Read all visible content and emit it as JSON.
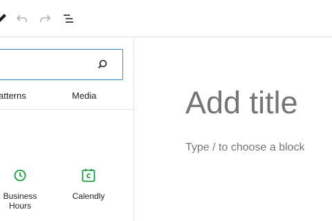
{
  "toolbar": {
    "items": [
      {
        "name": "edit-pencil-icon"
      },
      {
        "name": "undo-icon"
      },
      {
        "name": "redo-icon"
      },
      {
        "name": "document-overview-icon"
      }
    ]
  },
  "inserter": {
    "search": {
      "value": "",
      "placeholder": "",
      "icon": "search-icon"
    },
    "tabs": [
      {
        "label": "atterns"
      },
      {
        "label": "Media"
      }
    ],
    "blocks": [
      {
        "label": "Business Hours",
        "icon": "clock-icon",
        "color": "#1a9c3e"
      },
      {
        "label": "Calendly",
        "icon": "calendly-icon",
        "color": "#1a9c3e"
      }
    ]
  },
  "canvas": {
    "title_placeholder": "Add title",
    "appender_placeholder": "Type / to choose a block"
  },
  "colors": {
    "accent": "#3582c4",
    "block_icon": "#1a9c3e",
    "placeholder_text": "#757575"
  }
}
